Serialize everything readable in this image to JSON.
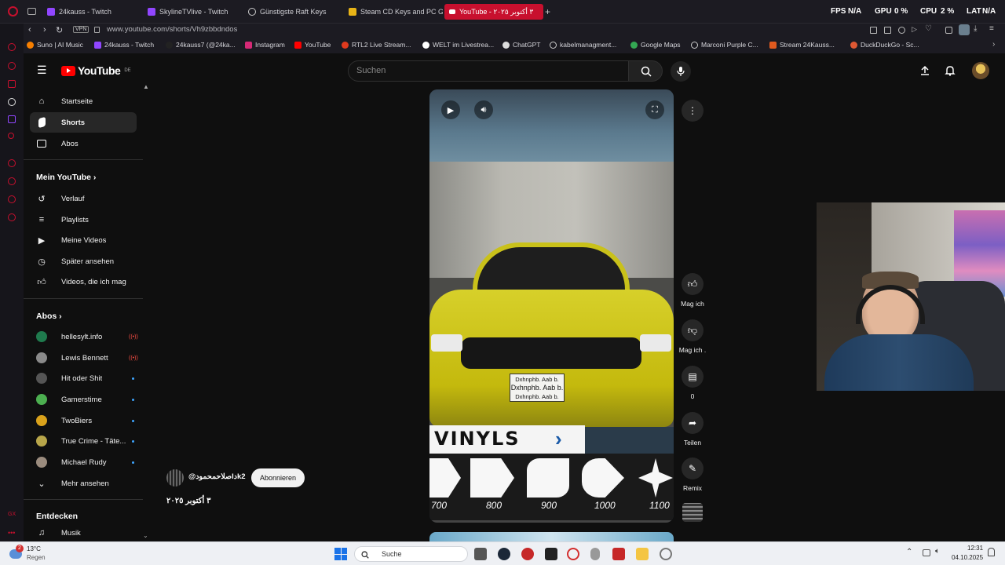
{
  "browser": {
    "tabs": [
      {
        "label": "24kauss - Twitch"
      },
      {
        "label": "SkylineTVlive - Twitch"
      },
      {
        "label": "Günstigste Raft Keys"
      },
      {
        "label": "Steam CD Keys and PC G"
      },
      {
        "label": "YouTube - ٣ أكتوبر ٢٠٢٥",
        "active": true
      }
    ],
    "system_stats": {
      "fps_label": "FPS",
      "fps_value": "N/A",
      "gpu_label": "GPU",
      "gpu_value": "0 %",
      "cpu_label": "CPU",
      "cpu_value": "2 %",
      "lat_label": "LAT",
      "lat_value": "N/A"
    },
    "vpn_label": "VPN",
    "url": "www.youtube.com/shorts/Vh9zbbdndos",
    "bookmarks": [
      {
        "label": "Suno | AI Music"
      },
      {
        "label": "24kauss - Twitch"
      },
      {
        "label": "24kauss7 (@24ka..."
      },
      {
        "label": "Instagram"
      },
      {
        "label": "YouTube"
      },
      {
        "label": "RTL2 Live Stream..."
      },
      {
        "label": "WELT im Livestrea..."
      },
      {
        "label": "ChatGPT"
      },
      {
        "label": "kabelmanagment..."
      },
      {
        "label": "Google Maps"
      },
      {
        "label": "Marconi Purple C..."
      },
      {
        "label": "Stream 24Kauss..."
      },
      {
        "label": "DuckDuckGo - Sc..."
      }
    ]
  },
  "youtube": {
    "logo_text": "YouTube",
    "region": "DE",
    "search_placeholder": "Suchen",
    "nav_main": [
      {
        "label": "Startseite",
        "icon": "home-icon"
      },
      {
        "label": "Shorts",
        "icon": "shorts-icon",
        "active": true
      },
      {
        "label": "Abos",
        "icon": "subscriptions-icon"
      }
    ],
    "mein_youtube_title": "Mein YouTube",
    "nav_you": [
      {
        "label": "Verlauf",
        "icon": "history-icon"
      },
      {
        "label": "Playlists",
        "icon": "playlists-icon"
      },
      {
        "label": "Meine Videos",
        "icon": "my-videos-icon"
      },
      {
        "label": "Später ansehen",
        "icon": "watch-later-icon"
      },
      {
        "label": "Videos, die ich mag",
        "icon": "liked-icon"
      }
    ],
    "abos_title": "Abos",
    "subscriptions": [
      {
        "label": "hellesylt.info",
        "status": "live",
        "color": "#1f7a4d"
      },
      {
        "label": "Lewis Bennett",
        "status": "live",
        "color": "#8a8a8a"
      },
      {
        "label": "Hit oder Shit",
        "status": "dot",
        "color": "#555555"
      },
      {
        "label": "Gamerstime",
        "status": "dot",
        "color": "#4caf50"
      },
      {
        "label": "TwoBiers",
        "status": "dot",
        "color": "#d9a21b"
      },
      {
        "label": "True Crime - Täte...",
        "status": "dot",
        "color": "#b8a64a"
      },
      {
        "label": "Michael Rudy",
        "status": "dot",
        "color": "#9b8c7e"
      }
    ],
    "show_more": "Mehr ansehen",
    "entdecken_title": "Entdecken",
    "entdecken_items": [
      {
        "label": "Musik",
        "icon": "music-icon"
      }
    ],
    "short": {
      "channel": "@صلاحمحمودlدk2",
      "subscribe": "Abonnieren",
      "date": "٣ أكتوبر ٢٠٢٥",
      "video_text": {
        "plate_line1": "Dxhnphb. Aab b.",
        "plate_line2": "Dxhnphb. Aab b.",
        "plate_line3": "Dxhnphb. Aab b.",
        "vinyls_label": "VINYLS",
        "prices": [
          "700",
          "800",
          "900",
          "1000",
          "1100"
        ]
      }
    },
    "actions": [
      {
        "label": "Mag ich",
        "icon": "like-icon"
      },
      {
        "label": "Mag ich .",
        "icon": "dislike-icon"
      },
      {
        "label": "0",
        "icon": "comment-icon"
      },
      {
        "label": "Teilen",
        "icon": "share-icon"
      },
      {
        "label": "Remix",
        "icon": "remix-icon"
      }
    ]
  },
  "taskbar": {
    "weather_temp": "13°C",
    "weather_desc": "Regen",
    "notification_count": "2",
    "search_label": "Suche",
    "time": "12:31",
    "date": "04.10.2025"
  }
}
